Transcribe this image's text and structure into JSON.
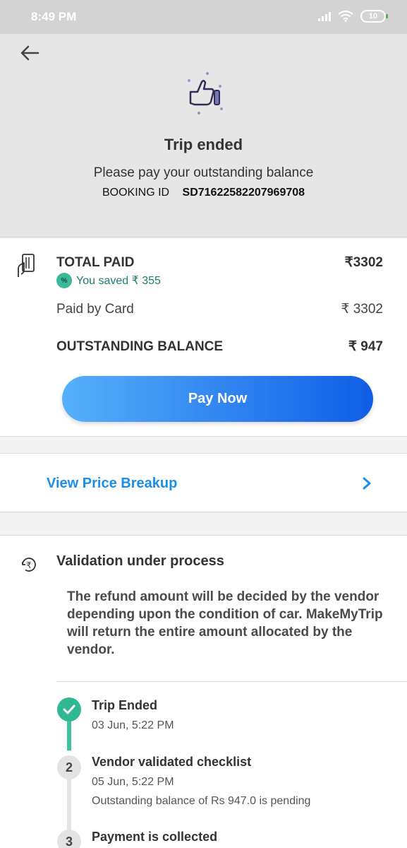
{
  "status_bar": {
    "time": "8:49 PM",
    "battery": "10"
  },
  "header": {
    "title": "Trip ended",
    "message": "Please pay your outstanding balance",
    "booking_id_label": "BOOKING ID",
    "booking_id_value": "SD71622582207969708"
  },
  "payment": {
    "total_paid_label": "TOTAL PAID",
    "total_paid_value": "₹3302",
    "saved_badge": "%",
    "saved_text": "You saved ₹ 355",
    "paid_by_card_label": "Paid by Card",
    "paid_by_card_value": "₹ 3302",
    "outstanding_label": "OUTSTANDING BALANCE",
    "outstanding_value": "₹ 947",
    "pay_now_label": "Pay Now"
  },
  "price_breakup": {
    "label": "View Price Breakup"
  },
  "validation": {
    "title": "Validation under process",
    "description": "The refund amount will be decided by the vendor depending upon the condition of car. MakeMyTrip will return the entire amount allocated by the vendor.",
    "steps": [
      {
        "number": "",
        "title": "Trip Ended",
        "date": "03 Jun, 5:22 PM",
        "note": ""
      },
      {
        "number": "2",
        "title": "Vendor validated checklist",
        "date": "05 Jun, 5:22 PM",
        "note": "Outstanding balance of Rs 947.0 is pending"
      },
      {
        "number": "3",
        "title": "Payment is collected",
        "date": "",
        "note": ""
      }
    ]
  },
  "colors": {
    "accent_blue": "#1a8ee9",
    "button_gradient_start": "#56b0fb",
    "button_gradient_end": "#0f5ee6",
    "step_done_green": "#2fb892",
    "saved_green": "#1a7f6b"
  }
}
